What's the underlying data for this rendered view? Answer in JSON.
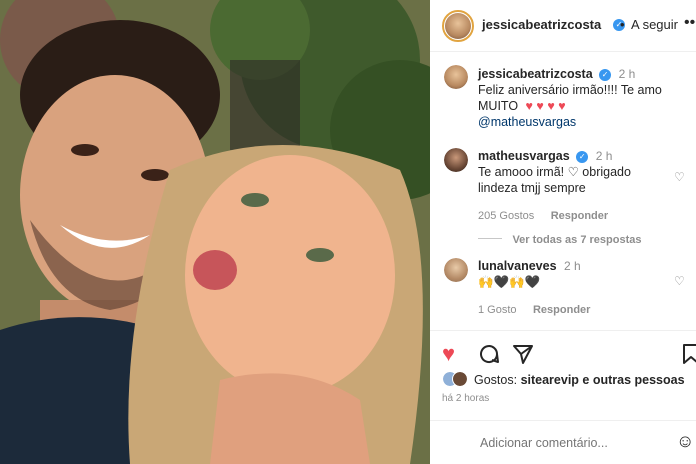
{
  "header": {
    "username": "jessicabeatrizcosta",
    "follow_label": "A seguir",
    "more_icon": "more-icon"
  },
  "caption": {
    "username": "jessicabeatrizcosta",
    "time": "2 h",
    "line1": "Feliz aniversário irmão!!!! Te amo",
    "line2": "MUITO",
    "hearts": "♥ ♥ ♥ ♥",
    "mention": "@matheusvargas"
  },
  "comments": [
    {
      "username": "matheusvargas",
      "time": "2 h",
      "line1": "Te amooo irmã! ♡ obrigado",
      "line2": "lindeza tmjj sempre",
      "likes": "205 Gostos",
      "reply": "Responder",
      "view_replies": "Ver todas as 7 respostas"
    },
    {
      "username": "lunalvaneves",
      "time": "2 h",
      "line1": "🙌🖤🙌🖤",
      "likes": "1 Gosto",
      "reply": "Responder"
    }
  ],
  "likes_row": {
    "prefix": "Gostos:",
    "account": "sitearevip",
    "suffix": "e outras pessoas"
  },
  "timestamp": "há 2 horas",
  "comment_input": {
    "placeholder": "Adicionar comentário..."
  },
  "colors": {
    "heart_red": "#ed4956",
    "verified_blue": "#3897f0",
    "link": "#00376b"
  }
}
